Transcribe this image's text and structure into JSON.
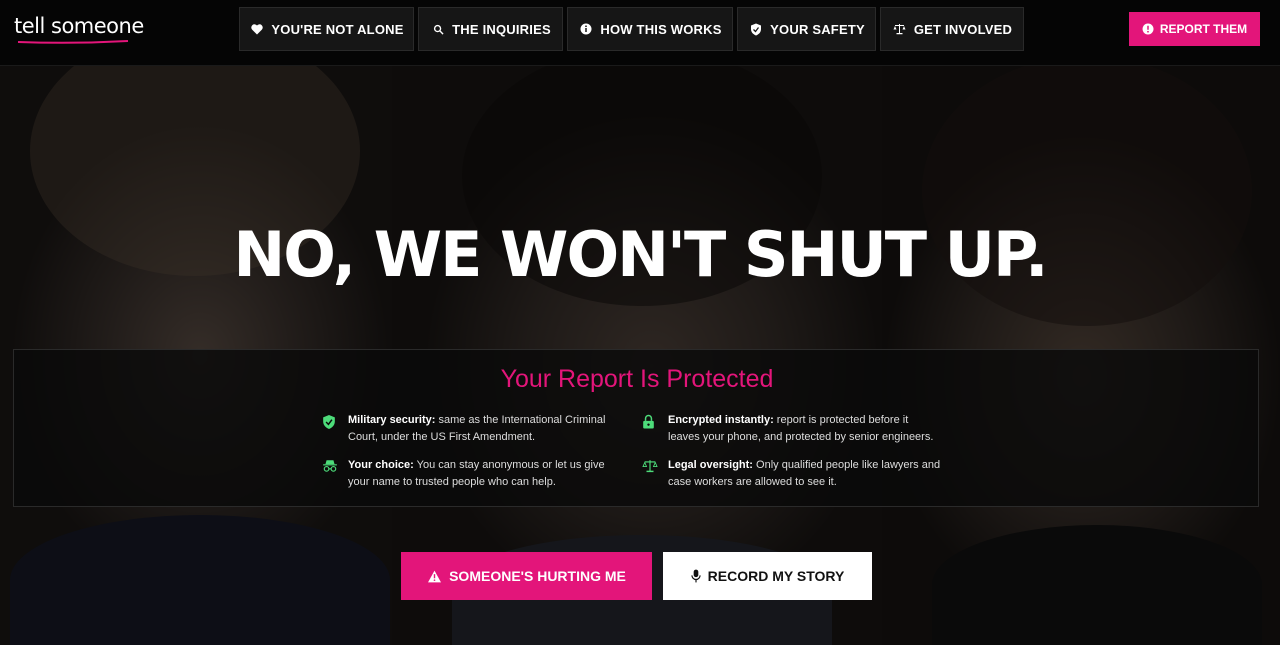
{
  "header": {
    "logo": "tell someone",
    "nav": [
      {
        "label": "YOU'RE NOT ALONE",
        "icon": "heart-icon"
      },
      {
        "label": "THE INQUIRIES",
        "icon": "search-icon"
      },
      {
        "label": "HOW THIS WORKS",
        "icon": "info-icon"
      },
      {
        "label": "YOUR SAFETY",
        "icon": "shield-check-icon"
      },
      {
        "label": "GET INVOLVED",
        "icon": "scales-icon"
      }
    ],
    "report_button": "REPORT THEM"
  },
  "hero": {
    "headline": "NO, WE WON'T SHUT UP.",
    "panel": {
      "title": "Your Report Is Protected",
      "features": [
        {
          "bold": "Military security:",
          "text": " same as the International Criminal Court, under the US First Amendment.",
          "icon": "shield-check-icon"
        },
        {
          "bold": "Encrypted instantly:",
          "text": " report is protected before it leaves your phone, and protected by senior engineers.",
          "icon": "lock-icon"
        },
        {
          "bold": "Your choice:",
          "text": " You can stay anonymous or let us give your name to trusted people who can help.",
          "icon": "incognito-icon"
        },
        {
          "bold": "Legal oversight:",
          "text": " Only qualified people like lawyers and case workers are allowed to see it.",
          "icon": "scales-icon"
        }
      ]
    },
    "cta_hurt": "SOMEONE'S HURTING ME",
    "cta_record": "RECORD MY STORY"
  },
  "colors": {
    "accent": "#e3157a",
    "feature_icon": "#4ddc7a",
    "header_bg": "#050505"
  }
}
